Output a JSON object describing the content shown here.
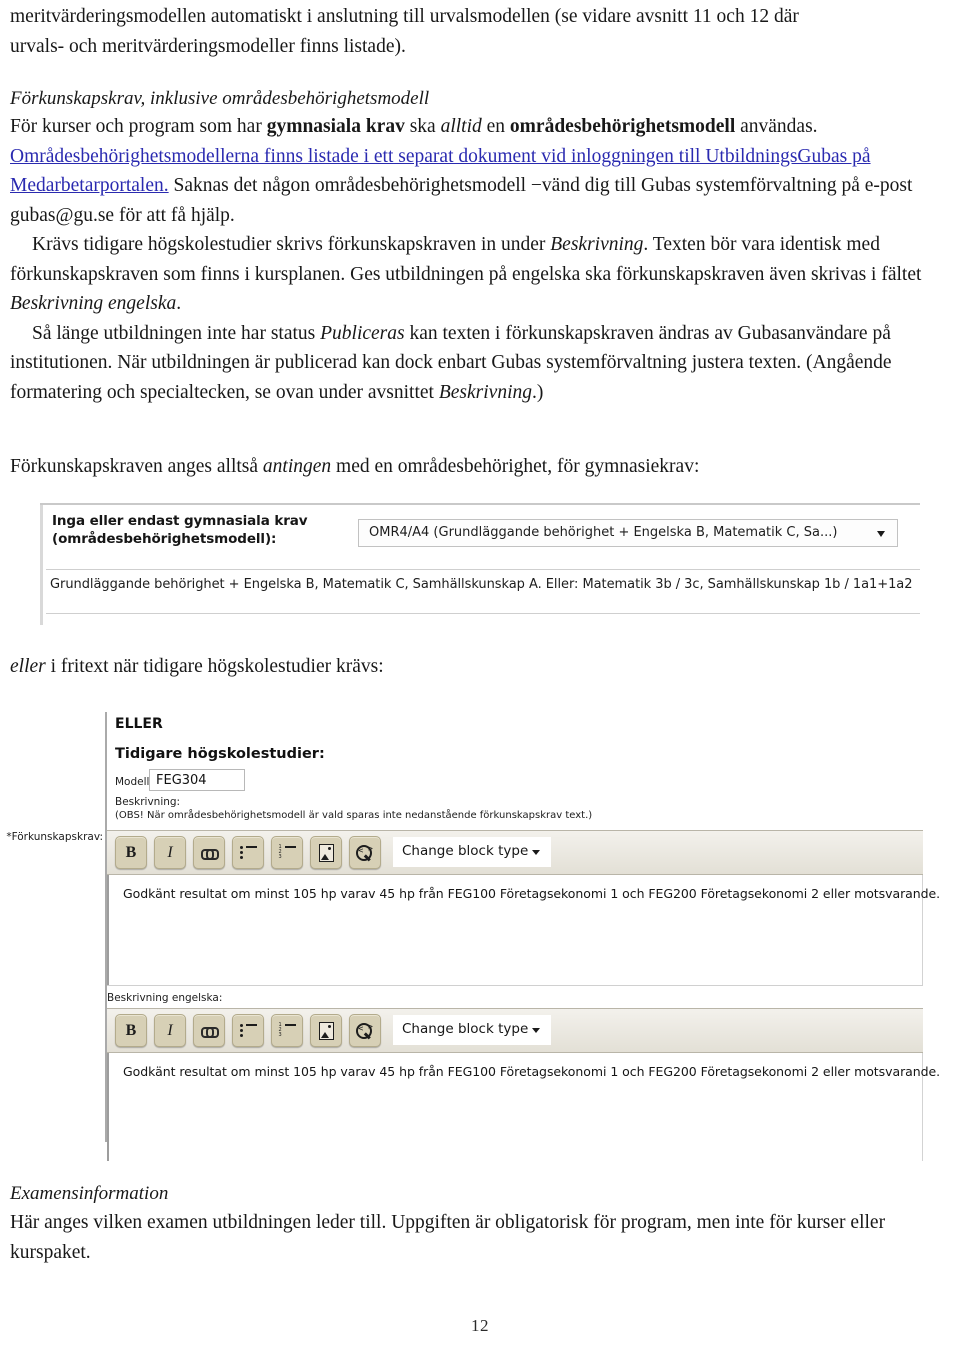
{
  "document": {
    "page_number": "12",
    "paragraph_top_line1": "meritvärderingsmodellen automatiskt i anslutning till urvalsmodellen (se vidare avsnitt 11 och 12 där",
    "paragraph_top_line2": "urvals- och meritvärderingsmodeller finns listade).",
    "section_heading": "Förkunskapskrav, inklusive områdesbehörighetsmodell",
    "body": {
      "s1_a": "För kurser och program som har ",
      "s1_b": "gymnasiala krav",
      "s1_c": " ska ",
      "s1_d": "alltid",
      "s1_e": " en ",
      "s1_f": "områdesbehörighetsmodell",
      "s1_g": " användas. ",
      "link_text": "Områdesbehörighetsmodellerna finns listade i ett separat dokument vid inloggningen till UtbildningsGubas på Medarbetarportalen.",
      "s2": " Saknas det någon områdesbehörighetsmodell −vänd dig till Gubas systemförvaltning på e-post gubas@gu.se för att få hjälp.",
      "p2_a": "Krävs tidigare högskolestudier skrivs förkunskapskraven in under ",
      "p2_b": "Beskrivning",
      "p2_c": ". Texten bör vara identisk med förkunskapskraven som finns i kursplanen. Ges utbildningen på engelska ska förkunskapskraven även skrivas i fältet ",
      "p2_d": "Beskrivning engelska",
      "p2_e": ".",
      "p3_a": "Så länge utbildningen inte har status ",
      "p3_b": "Publiceras",
      "p3_c": " kan texten i förkunskapskraven ändras av Gubasanvändare på institutionen. När utbildningen är publicerad kan dock enbart Gubas systemförvaltning justera texten. (Angående formatering och specialtecken, se ovan under avsnittet ",
      "p3_d": "Beskrivning",
      "p3_e": ".)"
    },
    "caption_before_shot_a_1": "Förkunskapskraven anges alltså ",
    "caption_before_shot_a_2": "antingen",
    "caption_before_shot_a_3": " med en områdesbehörighet, för gymnasiekrav:",
    "caption_before_shot_b_1": "eller",
    "caption_before_shot_b_2": " i fritext när tidigare högskolestudier krävs:",
    "exam_heading": "Examensinformation",
    "exam_body": "Här anges vilken examen utbildningen leder till. Uppgiften är obligatorisk för program, men inte för kurser eller kurspaket."
  },
  "screenshot_dropdown": {
    "field_label_line1": "Inga eller endast gymnasiala krav",
    "field_label_line2": "(områdesbehörighetsmodell):",
    "select_value": "OMR4/A4 (Grundläggande behörighet + Engelska B, Matematik C, Sa...)",
    "description_text": "Grundläggande behörighet + Engelska B, Matematik C, Samhällskunskap A. Eller: Matematik 3b / 3c, Samhällskunskap 1b / 1a1+1a2"
  },
  "screenshot_editor": {
    "side_label": "*Förkunskapskrav:",
    "eller_heading": "ELLER",
    "tidigare_heading": "Tidigare högskolestudier:",
    "modell_label": "Modell:",
    "modell_value": "FEG304",
    "beskrivning_label": "Beskrivning:",
    "obs_note": "(OBS! När områdesbehörighetsmodell är vald sparas inte nedanstående förkunskapskrav text.)",
    "beskrivning_engelska_label": "Beskrivning engelska:",
    "toolbar": {
      "bold_label": "B",
      "italic_label": "I",
      "link_label": "link-icon",
      "bullet_list_label": "bullet-list-icon",
      "numbered_list_label": "numbered-list-icon",
      "image_label": "image-icon",
      "source_label": "view-source-icon",
      "block_type_label": "Change block type",
      "ol_markers": [
        "1.",
        "2.",
        "3."
      ]
    },
    "content_sv": "Godkänt resultat om minst 105 hp varav 45 hp från FEG100 Företagsekonomi 1 och FEG200 Företagsekonomi 2 eller motsvarande.",
    "content_en": "Godkänt resultat om minst 105 hp varav 45 hp från FEG100 Företagsekonomi 1 och FEG200 Företagsekonomi 2 eller motsvarande."
  },
  "colors": {
    "link": "#2a2ab0",
    "toolbar_button": "#d7d0b6",
    "page_background": "#ffffff"
  }
}
